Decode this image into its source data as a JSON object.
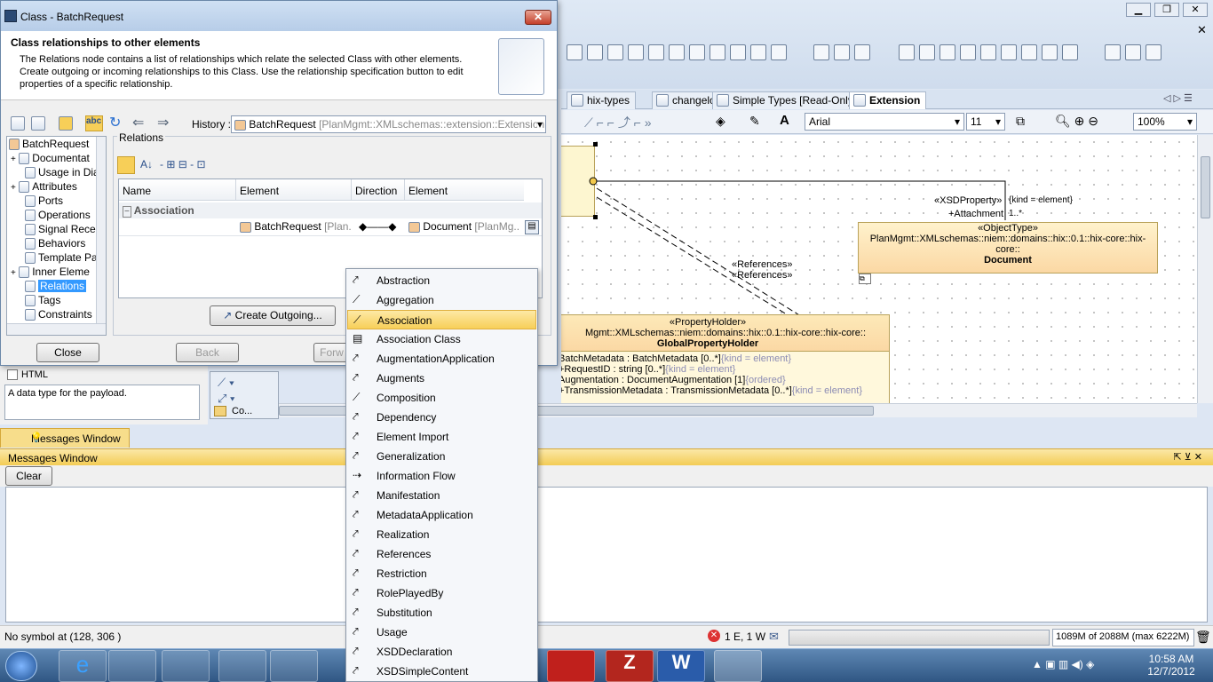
{
  "dialog": {
    "title": "Class - BatchRequest",
    "header_title": "Class relationships to other elements",
    "header_text": "The Relations node contains a list of relationships which relate the selected Class with other elements. Create outgoing or incoming relationships to this Class. Use the relationship specification button to edit properties of a specific relationship.",
    "history_label": "History :",
    "history_value": "BatchRequest",
    "history_path": "[PlanMgmt::XMLschemas::extension::Extension...",
    "close_button": "Close",
    "back_button": "Back",
    "forward_button": "Forw",
    "create_outgoing_button": "Create Outgoing...",
    "relations_label": "Relations"
  },
  "tree": {
    "items": [
      {
        "label": "BatchRequest",
        "exp": ""
      },
      {
        "label": "Documentat",
        "exp": "+"
      },
      {
        "label": "Usage in Dia",
        "exp": ""
      },
      {
        "label": "Attributes",
        "exp": "+"
      },
      {
        "label": "Ports",
        "exp": ""
      },
      {
        "label": "Operations",
        "exp": ""
      },
      {
        "label": "Signal Recep",
        "exp": ""
      },
      {
        "label": "Behaviors",
        "exp": ""
      },
      {
        "label": "Template Pa",
        "exp": ""
      },
      {
        "label": "Inner Eleme",
        "exp": "+"
      },
      {
        "label": "Relations",
        "exp": "",
        "selected": true
      },
      {
        "label": "Tags",
        "exp": ""
      },
      {
        "label": "Constraints",
        "exp": ""
      }
    ]
  },
  "table": {
    "headers": [
      "Name",
      "Element",
      "Direction",
      "Element"
    ],
    "group": "Association",
    "row": {
      "element1": "BatchRequest",
      "element1_path": "[Plan...",
      "element2": "Document",
      "element2_path": "[PlanMg..."
    }
  },
  "menu": {
    "items": [
      "Abstraction",
      "Aggregation",
      "Association",
      "Association Class",
      "AugmentationApplication",
      "Augments",
      "Composition",
      "Dependency",
      "Element Import",
      "Generalization",
      "Information Flow",
      "Manifestation",
      "MetadataApplication",
      "Realization",
      "References",
      "Restriction",
      "RolePlayedBy",
      "Substitution",
      "Usage",
      "XSDDeclaration",
      "XSDSimpleContent"
    ],
    "selected_index": 2
  },
  "tabs": [
    "hix-types",
    "changelog",
    "Simple Types [Read-Only]",
    "Extension"
  ],
  "format": {
    "font": "Arial",
    "size": "11",
    "zoom": "100%"
  },
  "diagram": {
    "object_type_stereo": "«ObjectType»",
    "object_type_path": "PlanMgmt::XMLschemas::niem::domains::hix::0.1::hix-core::hix-core::",
    "object_type_name": "Document",
    "xsd_property": "«XSDProperty»",
    "attachment": "+Attachment",
    "attachment_mult": "1..*",
    "kind_element": "{kind = element}",
    "references1": "«References»",
    "references2": "«References»",
    "prop_holder_stereo": "«PropertyHolder»",
    "prop_holder_path": "Mgmt::XMLschemas::niem::domains::hix::0.1::hix-core::hix-core::",
    "prop_holder_name": "GlobalPropertyHolder",
    "attrs": [
      {
        "a": "BatchMetadata : BatchMetadata [0..*]",
        "b": "{kind = element}"
      },
      {
        "a": "+RequestID : string [0..*]",
        "b": "{kind = element}"
      },
      {
        "a": "Augmentation : DocumentAugmentation [1]",
        "b": "{ordered}"
      },
      {
        "a": "+TransmissionMetadata : TransmissionMetadata [0..*]",
        "b": "{kind = element}"
      }
    ]
  },
  "description": {
    "label": "HTML",
    "text": "A data type for the payload."
  },
  "messages": {
    "tab": "Messages Window",
    "title": "Messages Window",
    "clear_button": "Clear"
  },
  "status": {
    "text": "No symbol at (128, 306 )",
    "errors": "1 E, 1 W",
    "memory": "1089M of 2088M (max 6222M)"
  },
  "taskbar": {
    "time": "10:58 AM",
    "date": "12/7/2012"
  },
  "explorer_label": "Co..."
}
